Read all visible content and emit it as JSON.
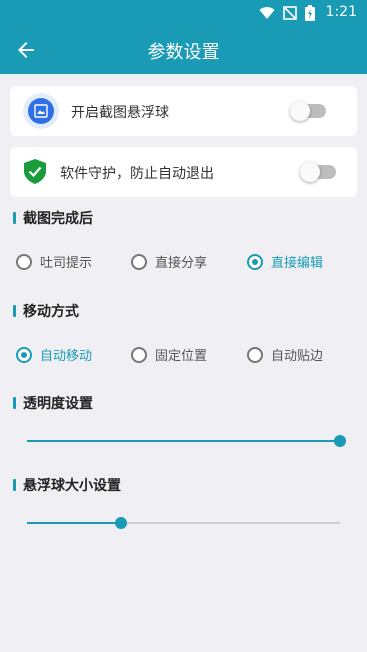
{
  "status_bar": {
    "time": "1:21",
    "icons": [
      "wifi-icon",
      "no-signal-icon",
      "battery-charging-icon"
    ]
  },
  "toolbar": {
    "title": "参数设置",
    "back_icon": "arrow-left-icon"
  },
  "floating_ball": {
    "label": "开启截图悬浮球",
    "enabled": false
  },
  "protect": {
    "label": "软件守护，防止自动退出",
    "enabled": false
  },
  "after_screenshot": {
    "title": "截图完成后",
    "options": [
      "吐司提示",
      "直接分享",
      "直接编辑"
    ],
    "selected": 2
  },
  "move_mode": {
    "title": "移动方式",
    "options": [
      "自动移动",
      "固定位置",
      "自动贴边"
    ],
    "selected": 0
  },
  "transparency": {
    "title": "透明度设置",
    "value_fraction": 1.0
  },
  "ball_size": {
    "title": "悬浮球大小设置",
    "value_fraction": 0.3
  },
  "colors": {
    "accent": "#1a9bb5",
    "background": "#efeff4"
  }
}
